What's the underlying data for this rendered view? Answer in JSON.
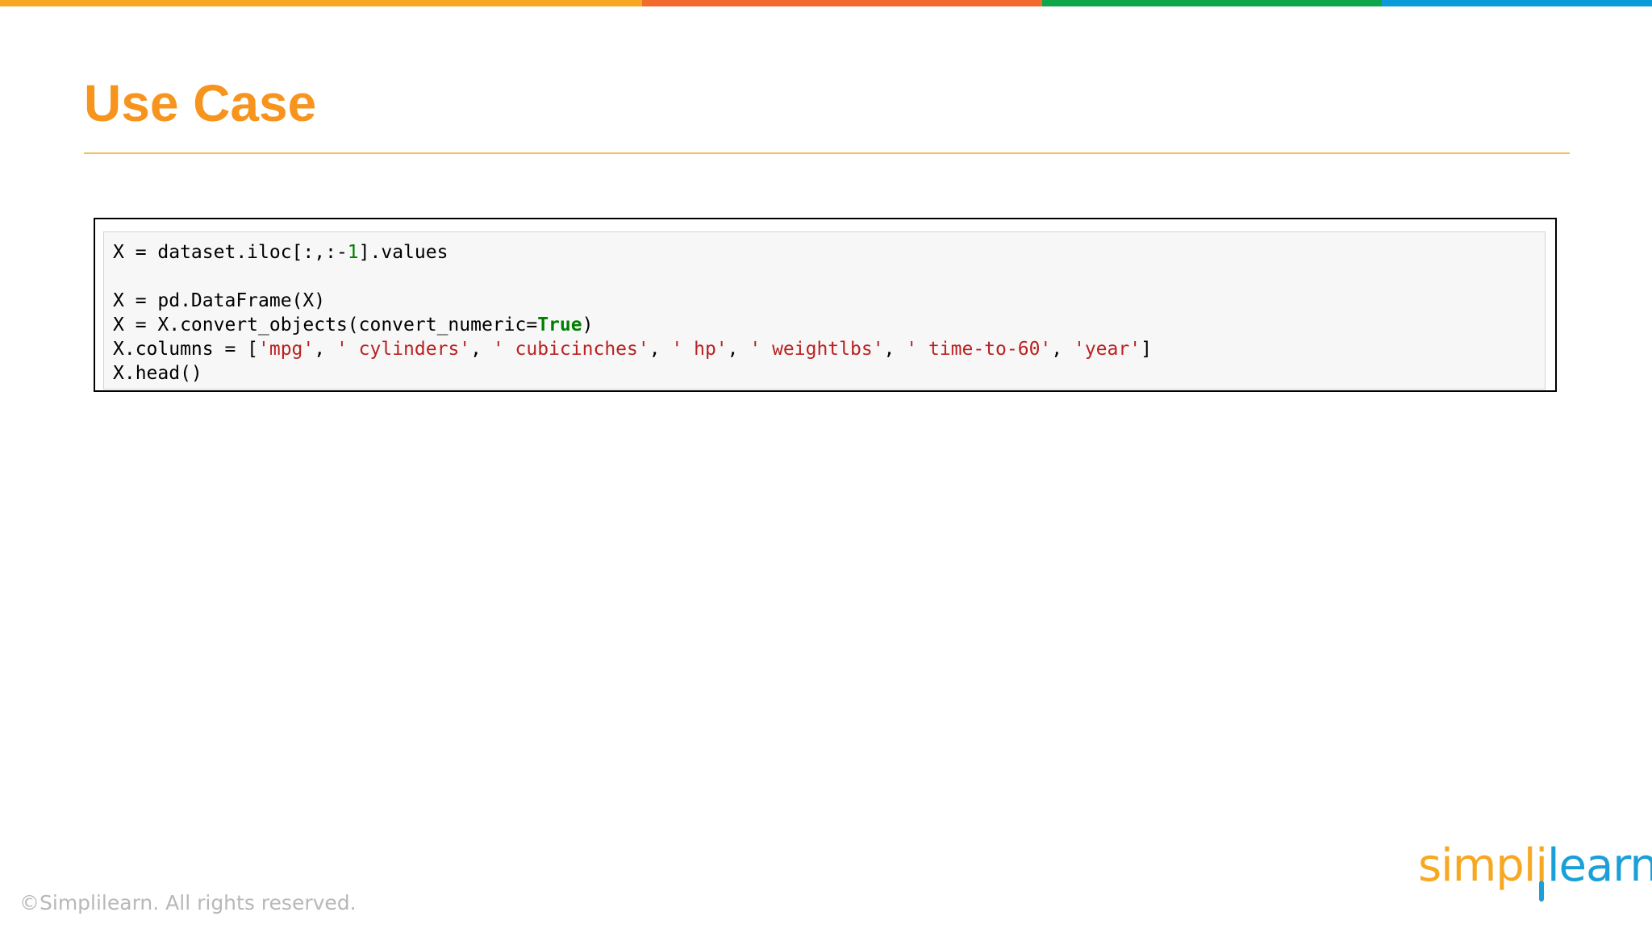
{
  "colors": {
    "bar_segments": [
      "#f7a823",
      "#f26b2d",
      "#0fa64a",
      "#0b9bd9"
    ],
    "title": "#f7941d",
    "rule": "#f0c05a",
    "string": "#ba2121",
    "number": "#008000",
    "keyword": "#008000",
    "copyright": "#b8b8b8",
    "logo_orange": "#f7a823",
    "logo_blue": "#1b9fd9"
  },
  "slide": {
    "title": "Use Case"
  },
  "code": {
    "line1": {
      "a": "X = dataset.iloc[:,:-",
      "num": "1",
      "b": "].values"
    },
    "line2": "X = pd.DataFrame(X)",
    "line3": {
      "a": "X = X.convert_objects(convert_numeric=",
      "kw": "True",
      "b": ")"
    },
    "line4": {
      "a": "X.columns = [",
      "s1": "'mpg'",
      "s2": "' cylinders'",
      "s3": "' cubicinches'",
      "s4": "' hp'",
      "s5": "' weightlbs'",
      "s6": "' time-to-60'",
      "s7": "'year'",
      "sep": ", ",
      "end": "]"
    },
    "line5": "X.head()"
  },
  "footer": {
    "copyright": "©Simplilearn. All rights reserved.",
    "logo": {
      "part1": "simpl",
      "part2": "i",
      "part3": "learn"
    }
  }
}
